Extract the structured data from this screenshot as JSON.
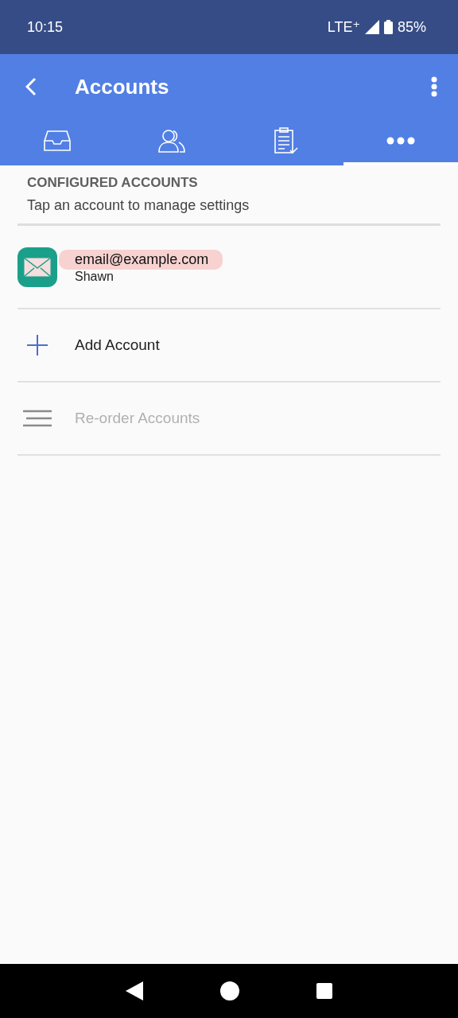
{
  "status_bar": {
    "time": "10:15",
    "network": "LTE⁺",
    "battery": "85%"
  },
  "app_bar": {
    "title": "Accounts"
  },
  "tabs": [
    {
      "selected": false
    },
    {
      "selected": false
    },
    {
      "selected": false
    },
    {
      "selected": true
    }
  ],
  "section": {
    "heading": "CONFIGURED ACCOUNTS",
    "subtitle": "Tap an account to manage settings"
  },
  "accounts": [
    {
      "email": "email@example.com",
      "name": "Shawn",
      "highlighted": true
    }
  ],
  "actions": [
    {
      "kind": "add",
      "label": "Add Account",
      "disabled": false
    },
    {
      "kind": "reorder",
      "label": "Re-order Accounts",
      "disabled": true
    }
  ]
}
